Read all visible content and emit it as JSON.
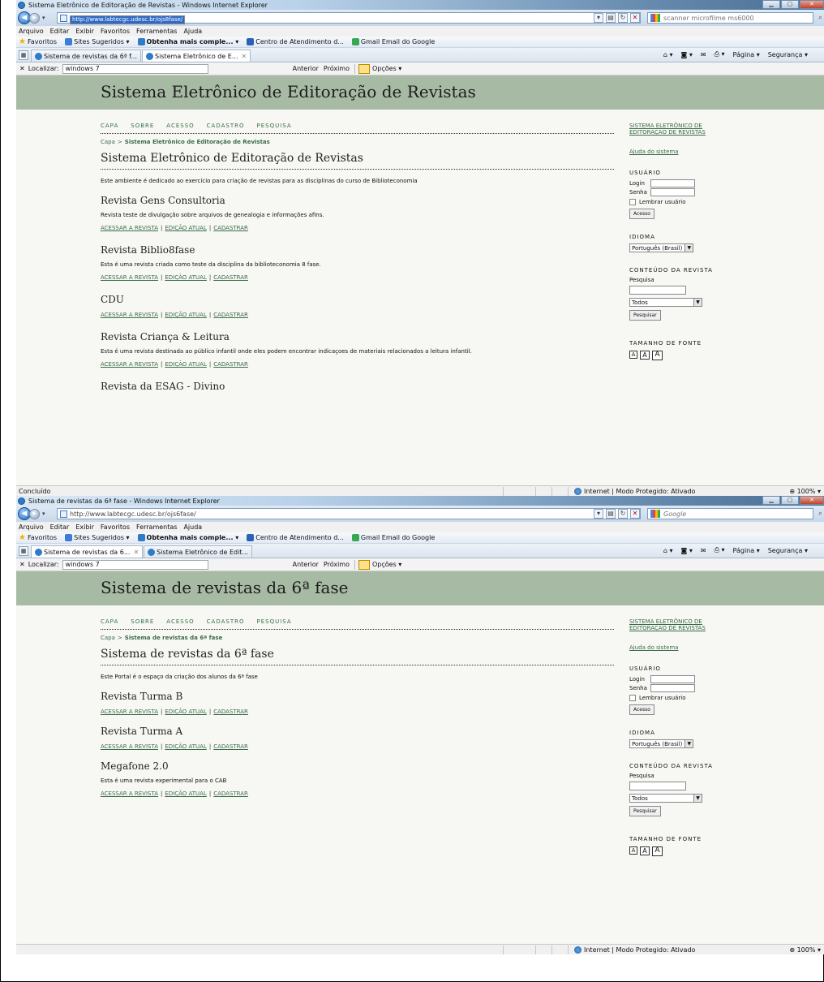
{
  "windows": [
    {
      "title": "Sistema Eletrônico de Editoração de Revistas - Windows Internet Explorer",
      "url_host": "http://www.labtecgc.udesc.br/ojs8fase/",
      "search_text": "scanner microfilme ms6000",
      "menu": [
        "Arquivo",
        "Editar",
        "Exibir",
        "Favoritos",
        "Ferramentas",
        "Ajuda"
      ],
      "favorites": {
        "label": "Favoritos",
        "items": [
          "Sites Sugeridos ▾",
          "Obtenha mais comple... ▾",
          "Centro de Atendimento d...",
          "Gmail Email do Google"
        ]
      },
      "tabs": [
        "Sistema de revistas da 6ª f...",
        "Sistema Eletrônico de E..."
      ],
      "active_tab": 1,
      "command_bar": [
        "Página ▾",
        "Segurança ▾"
      ],
      "find": {
        "label": "Localizar:",
        "value": "windows 7",
        "prev": "Anterior",
        "next": "Próximo",
        "options": "Opções ▾"
      },
      "site": {
        "banner": "Sistema Eletrônico de Editoração de Revistas",
        "nav": [
          "CAPA",
          "SOBRE",
          "ACESSO",
          "CADASTRO",
          "PESQUISA"
        ],
        "crumb_home": "Capa",
        "crumb_sep": ">",
        "crumb_current": "Sistema Eletrônico de Editoração de Revistas",
        "page_title": "Sistema Eletrônico de Editoração de Revistas",
        "intro": "Este ambiente é dedicado ao exercício para criação de revistas para as disciplinas do curso de Biblioteconomia",
        "journals": [
          {
            "title": "Revista Gens Consultoria",
            "desc": "Revista teste de divulgação sobre arquivos de genealogia e informações afins."
          },
          {
            "title": "Revista Biblio8fase",
            "desc": "Esta é uma revista criada como teste da disciplina da biblioteconomia 8 fase."
          },
          {
            "title": "CDU",
            "desc": ""
          },
          {
            "title": "Revista Criança & Leitura",
            "desc": "Esta é uma revista destinada ao público infantil onde eles podem encontrar indicaçoes de materiais relacionados a leitura infantil."
          },
          {
            "title": "Revista da ESAG - Divino",
            "desc": ""
          }
        ]
      },
      "status_left": "Concluído",
      "status_zone": "Internet | Modo Protegido: Ativado",
      "status_zoom": "100%"
    },
    {
      "title": "Sistema de revistas da 6ª fase - Windows Internet Explorer",
      "url_host": "http://www.labtecgc.udesc.br/ojs6fase/",
      "search_text": "Google",
      "menu": [
        "Arquivo",
        "Editar",
        "Exibir",
        "Favoritos",
        "Ferramentas",
        "Ajuda"
      ],
      "favorites": {
        "label": "Favoritos",
        "items": [
          "Sites Sugeridos ▾",
          "Obtenha mais comple... ▾",
          "Centro de Atendimento d...",
          "Gmail Email do Google"
        ]
      },
      "tabs": [
        "Sistema de revistas da 6...",
        "Sistema Eletrônico de Edit..."
      ],
      "active_tab": 0,
      "command_bar": [
        "Página ▾",
        "Segurança ▾"
      ],
      "find": {
        "label": "Localizar:",
        "value": "windows 7",
        "prev": "Anterior",
        "next": "Próximo",
        "options": "Opções ▾"
      },
      "site": {
        "banner": "Sistema de revistas da 6ª fase",
        "nav": [
          "CAPA",
          "SOBRE",
          "ACESSO",
          "CADASTRO",
          "PESQUISA"
        ],
        "crumb_home": "Capa",
        "crumb_sep": ">",
        "crumb_current": "Sistema de revistas da 6ª fase",
        "page_title": "Sistema de revistas da 6ª fase",
        "intro": "Este Portal é o espaço da criação dos alunos da 6ª fase",
        "journals": [
          {
            "title": "Revista Turma B",
            "desc": ""
          },
          {
            "title": "Revista Turma A",
            "desc": ""
          },
          {
            "title": "Megafone 2.0",
            "desc": "Esta é uma revista experimental para o CAB"
          }
        ]
      },
      "status_left": "",
      "status_zone": "Internet | Modo Protegido: Ativado",
      "status_zoom": "100%"
    }
  ],
  "journal_links": {
    "access": "ACESSAR A REVISTA",
    "current": "EDIÇÃO ATUAL",
    "register": "CADASTRAR",
    "sep": "|"
  },
  "sidebar": {
    "system_link_line1": "SISTEMA ELETRÔNICO DE",
    "system_link_line2": "EDITORAÇÃO DE REVISTAS",
    "help": "Ajuda do sistema",
    "user_heading": "USUÁRIO",
    "login_label": "Login",
    "password_label": "Senha",
    "remember": "Lembrar usuário",
    "login_button": "Acesso",
    "language_heading": "IDIOMA",
    "language_value": "Português (Brasil)",
    "content_heading": "CONTEÚDO DA REVISTA",
    "search_label": "Pesquisa",
    "scope_value": "Todos",
    "search_button": "Pesquisar",
    "font_heading": "TAMANHO DE FONTE",
    "font_sizes": [
      "A",
      "A",
      "A"
    ]
  },
  "colors": {
    "banner": "#a7bba4",
    "link": "#3a6b4a",
    "page_bg": "#f7f8f3"
  },
  "icons": [
    "back-icon",
    "forward-icon",
    "refresh-icon",
    "stop-icon",
    "search-icon",
    "home-icon",
    "feed-icon",
    "print-icon",
    "globe-icon",
    "zoom-icon",
    "star-icon"
  ]
}
